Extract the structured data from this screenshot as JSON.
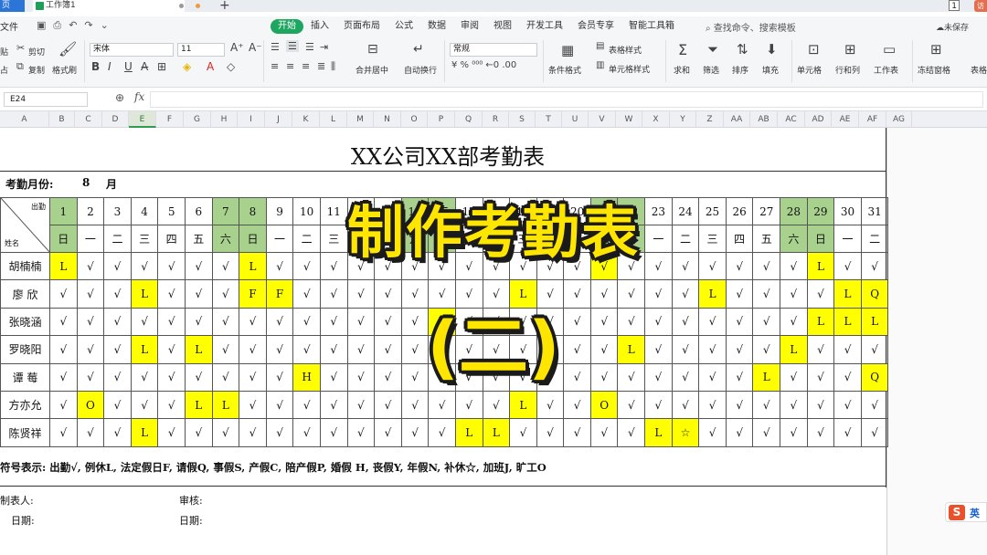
{
  "app": {
    "tab_home": "页",
    "doc_tab": "工作簿1",
    "tab_plus": "+",
    "page_indicator": "1",
    "user_badge": "访"
  },
  "menu": {
    "file_label": "文件",
    "items": [
      "开始",
      "插入",
      "页面布局",
      "公式",
      "数据",
      "审阅",
      "视图",
      "开发工具",
      "会员专享",
      "智能工具箱"
    ],
    "active": "开始",
    "search_cmd": "查找命令、搜索模板",
    "cloud_save": "未保存"
  },
  "ribbon": {
    "cut": "剪切",
    "copy": "复制",
    "format_painter": "格式刷",
    "font_name": "宋体",
    "font_size": "11",
    "merge_center": "合并居中",
    "wrap_text": "自动换行",
    "number_format": "常规",
    "cond_format": "条件格式",
    "table_style": "表格样式",
    "cell_style": "单元格样式",
    "sum": "求和",
    "filter": "筛选",
    "sort": "排序",
    "fill": "填充",
    "cell": "单元格",
    "row_col": "行和列",
    "worksheet": "工作表",
    "freeze": "冻结窗格",
    "table_more": "表格",
    "paste": "贴",
    "paste2": "占"
  },
  "formula_bar": {
    "name_box": "E24",
    "fx": "fx",
    "formula": ""
  },
  "columns": [
    "A",
    "B",
    "C",
    "D",
    "E",
    "F",
    "G",
    "H",
    "I",
    "J",
    "K",
    "L",
    "M",
    "N",
    "O",
    "P",
    "Q",
    "R",
    "S",
    "T",
    "U",
    "V",
    "W",
    "X",
    "Y",
    "Z",
    "AA",
    "AB",
    "AC",
    "AD",
    "AE",
    "AF",
    "AG"
  ],
  "selected_column": "E",
  "sheet": {
    "title": "XX公司XX部考勤表",
    "month_label": "考勤月份:",
    "month_value": "8",
    "month_unit": "月",
    "header_attend": "出勤",
    "header_name": "姓名",
    "days": [
      "1",
      "2",
      "3",
      "4",
      "5",
      "6",
      "7",
      "8",
      "9",
      "10",
      "11",
      "12",
      "13",
      "14",
      "15",
      "16",
      "17",
      "18",
      "19",
      "20",
      "21",
      "22",
      "23",
      "24",
      "25",
      "26",
      "27",
      "28",
      "29",
      "30",
      "31"
    ],
    "weekdays": [
      "日",
      "一",
      "二",
      "三",
      "四",
      "五",
      "六",
      "日",
      "一",
      "二",
      "三",
      "四",
      "五",
      "六",
      "日",
      "一",
      "二",
      "三",
      "四",
      "五",
      "六",
      "日",
      "一",
      "二",
      "三",
      "四",
      "五",
      "六",
      "日",
      "一",
      "二"
    ],
    "weekend_days": [
      1,
      7,
      8,
      14,
      15,
      21,
      22,
      28,
      29
    ],
    "rows": [
      {
        "name": "胡楠楠",
        "marks": [
          "L",
          "√",
          "√",
          "√",
          "√",
          "√",
          "√",
          "L",
          "√",
          "√",
          "√",
          "√",
          "√",
          "√",
          "√",
          "√",
          "√",
          "√",
          "√",
          "√",
          "√",
          "√",
          "√",
          "√",
          "√",
          "√",
          "√",
          "√",
          "L",
          "√",
          "√"
        ],
        "highlight": [
          1,
          8,
          21,
          29
        ]
      },
      {
        "name": "廖  欣",
        "marks": [
          "√",
          "√",
          "√",
          "L",
          "√",
          "√",
          "√",
          "F",
          "F",
          "√",
          "√",
          "√",
          "√",
          "√",
          "√",
          "√",
          "√",
          "L",
          "√",
          "√",
          "√",
          "√",
          "√",
          "√",
          "L",
          "√",
          "√",
          "√",
          "√",
          "L",
          "Q"
        ],
        "highlight": [
          4,
          8,
          9,
          18,
          25,
          30,
          31
        ]
      },
      {
        "name": "张晓涵",
        "marks": [
          "√",
          "√",
          "√",
          "√",
          "√",
          "√",
          "√",
          "√",
          "√",
          "√",
          "√",
          "√",
          "√",
          "√",
          "L",
          "√",
          "√",
          "√",
          "√",
          "√",
          "√",
          "√",
          "√",
          "√",
          "√",
          "√",
          "√",
          "√",
          "L",
          "L",
          "L"
        ],
        "highlight": [
          15,
          29,
          30,
          31
        ]
      },
      {
        "name": "罗晓阳",
        "marks": [
          "√",
          "√",
          "√",
          "L",
          "√",
          "L",
          "√",
          "√",
          "√",
          "√",
          "√",
          "√",
          "√",
          "√",
          "√",
          "√",
          "√",
          "√",
          "√",
          "√",
          "√",
          "L",
          "√",
          "√",
          "√",
          "√",
          "√",
          "L",
          "√",
          "√",
          "√"
        ],
        "highlight": [
          4,
          6,
          22,
          28
        ]
      },
      {
        "name": "谭  莓",
        "marks": [
          "√",
          "√",
          "√",
          "√",
          "√",
          "√",
          "√",
          "√",
          "√",
          "H",
          "√",
          "√",
          "√",
          "√",
          "√",
          "√",
          "√",
          "√",
          "√",
          "√",
          "√",
          "√",
          "√",
          "√",
          "√",
          "√",
          "L",
          "√",
          "√",
          "√",
          "Q"
        ],
        "highlight": [
          10,
          27,
          31
        ]
      },
      {
        "name": "方亦允",
        "marks": [
          "√",
          "O",
          "√",
          "√",
          "√",
          "L",
          "L",
          "√",
          "√",
          "√",
          "√",
          "√",
          "√",
          "√",
          "√",
          "√",
          "√",
          "L",
          "√",
          "√",
          "O",
          "√",
          "√",
          "√",
          "√",
          "√",
          "√",
          "√",
          "√",
          "√",
          "√"
        ],
        "highlight": [
          2,
          6,
          7,
          18,
          21
        ]
      },
      {
        "name": "陈贤祥",
        "marks": [
          "√",
          "√",
          "√",
          "L",
          "√",
          "√",
          "√",
          "√",
          "√",
          "√",
          "√",
          "√",
          "√",
          "√",
          "√",
          "L",
          "L",
          "√",
          "√",
          "√",
          "√",
          "√",
          "L",
          "☆",
          "√",
          "√",
          "√",
          "√",
          "√",
          "√",
          "√"
        ],
        "highlight": [
          4,
          16,
          17,
          23,
          24
        ]
      }
    ],
    "legend": "符号表示: 出勤√, 例休L, 法定假日F, 请假Q, 事假S,  产假C,  陪产假P,  婚假 H,  丧假Y, 年假N,   补休☆, 加班J, 旷工O",
    "prepared_by": "制表人:",
    "reviewed_by": "审核:",
    "date1": "日期:",
    "date2": "日期:"
  },
  "overlay": {
    "title": "制作考勤表",
    "subtitle": "(二)"
  },
  "ime": {
    "logo": "S",
    "mode": "英"
  },
  "colors": {
    "highlight": "#ffff00",
    "weekend": "#a9d18e",
    "accent": "#1da660",
    "overlay_text": "#ffe600"
  }
}
